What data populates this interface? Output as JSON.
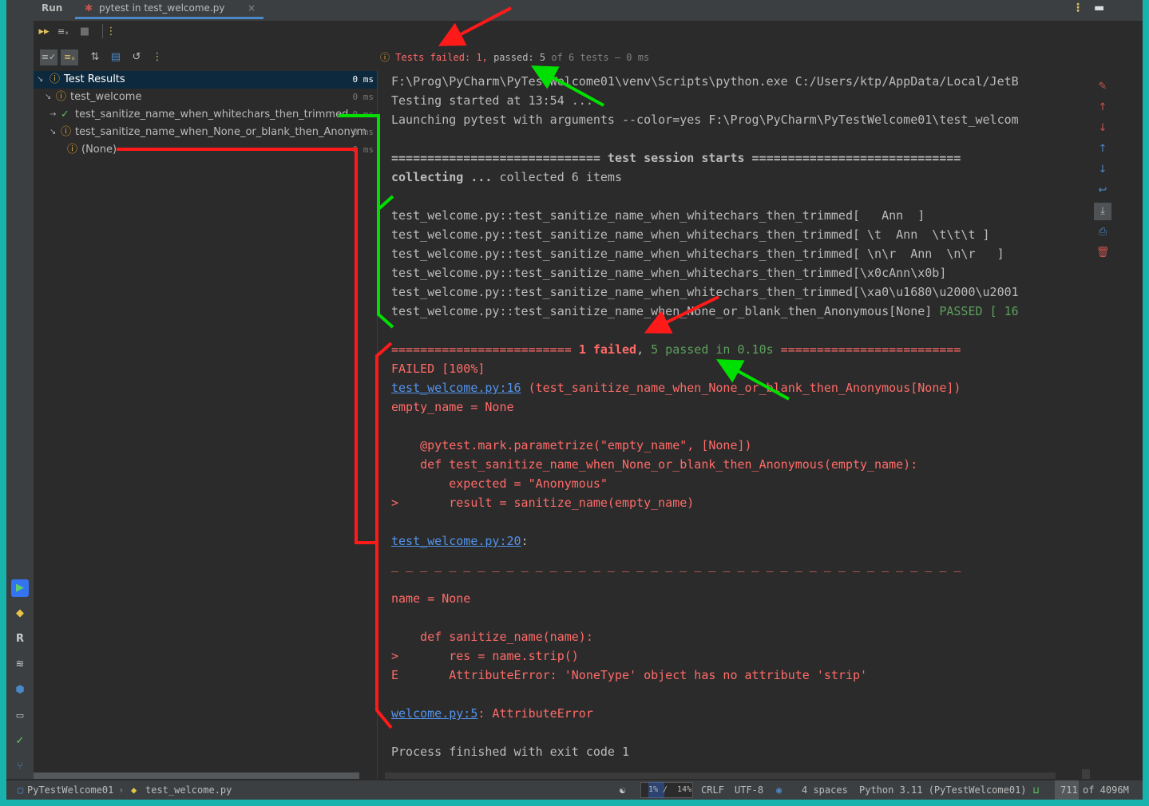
{
  "topbar": {
    "run_label": "Run",
    "tab_label": "pytest in test_welcome.py",
    "tab_close": "×"
  },
  "status": {
    "failed_label": "Tests failed: 1,",
    "passed_label": "passed:",
    "passed_count": "5",
    "of_label": "of",
    "total_label": "6 tests",
    "duration": "– 0 ms"
  },
  "tree": {
    "items": [
      {
        "label": "Test Results",
        "time": "0 ms",
        "status": "failed"
      },
      {
        "label": "test_welcome",
        "time": "0 ms",
        "status": "failed"
      },
      {
        "label": "test_sanitize_name_when_whitechars_then_trimmed",
        "time": "0 ms",
        "status": "passed"
      },
      {
        "label": "test_sanitize_name_when_None_or_blank_then_Anonym",
        "time": "0 ms",
        "status": "failed"
      },
      {
        "label": "(None)",
        "time": "0 ms",
        "status": "failed"
      }
    ]
  },
  "console": {
    "l01": "F:\\Prog\\PyCharm\\PyTestWelcome01\\venv\\Scripts\\python.exe C:/Users/ktp/AppData/Local/JetB",
    "l02": "Testing started at 13:54 ...",
    "l03": "Launching pytest with arguments --color=yes F:\\Prog\\PyCharm\\PyTestWelcome01\\test_welcom",
    "l05": "============================= test session starts =============================",
    "l06a": "collecting ... ",
    "l06b": "collected 6 items",
    "t1": "test_welcome.py::test_sanitize_name_when_whitechars_then_trimmed[   Ann  ]",
    "t2": "test_welcome.py::test_sanitize_name_when_whitechars_then_trimmed[ \\t  Ann  \\t\\t\\t ]",
    "t3": "test_welcome.py::test_sanitize_name_when_whitechars_then_trimmed[ \\n\\r  Ann  \\n\\r   ]",
    "t4": "test_welcome.py::test_sanitize_name_when_whitechars_then_trimmed[\\x0cAnn\\x0b]",
    "t5": "test_welcome.py::test_sanitize_name_when_whitechars_then_trimmed[\\xa0\\u1680\\u2000\\u2001",
    "t6": "test_welcome.py::test_sanitize_name_when_None_or_blank_then_Anonymous[None] ",
    "t6_passed": "PASSED [ 16",
    "sum_pre": "========================= ",
    "sum_failed": "1 failed",
    "sum_comma": ", ",
    "sum_passed": "5 passed in 0.10s",
    "sum_post": " =========================",
    "failed_pct": "FAILED [100%]",
    "loc1_link": "test_welcome.py:16",
    "loc1_rest": " (test_sanitize_name_when_None_or_blank_then_Anonymous[None])",
    "empty_name": "empty_name = None",
    "code1": "    @pytest.mark.parametrize(\"empty_name\", [None])",
    "code2": "    def test_sanitize_name_when_None_or_blank_then_Anonymous(empty_name):",
    "code3": "        expected = \"Anonymous\"",
    "code4": ">       result = sanitize_name(empty_name)",
    "loc2_link": "test_welcome.py:20",
    "loc2_rest": ":",
    "dashes": "_ _ _ _ _ _ _ _ _ _ _ _ _ _ _ _ _ _ _ _ _ _ _ _ _ _ _ _ _ _ _ _ _ _ _ _ _ _ _ _",
    "name_none": "name = None",
    "code5": "    def sanitize_name(name):",
    "code6": ">       res = name.strip()",
    "code7": "E       AttributeError: 'NoneType' object has no attribute 'strip'",
    "loc3_link": "welcome.py:5",
    "loc3_rest": ": AttributeError",
    "finished": "Process finished with exit code 1"
  },
  "statusbar": {
    "project": "PyTestWelcome01",
    "file": "test_welcome.py",
    "mem_a": "1% /",
    "mem_b": "14%",
    "line_sep": "CRLF",
    "encoding": "UTF-8",
    "indent": "4 spaces",
    "interpreter": "Python 3.11 (PyTestWelcome01)",
    "heap_used": "711",
    "heap_of": "of 4096M"
  },
  "colors": {
    "fail": "#ff6b68",
    "pass": "#5da05d",
    "link": "#5394ec",
    "warn": "#f0a732",
    "accent": "#4a88c7"
  }
}
